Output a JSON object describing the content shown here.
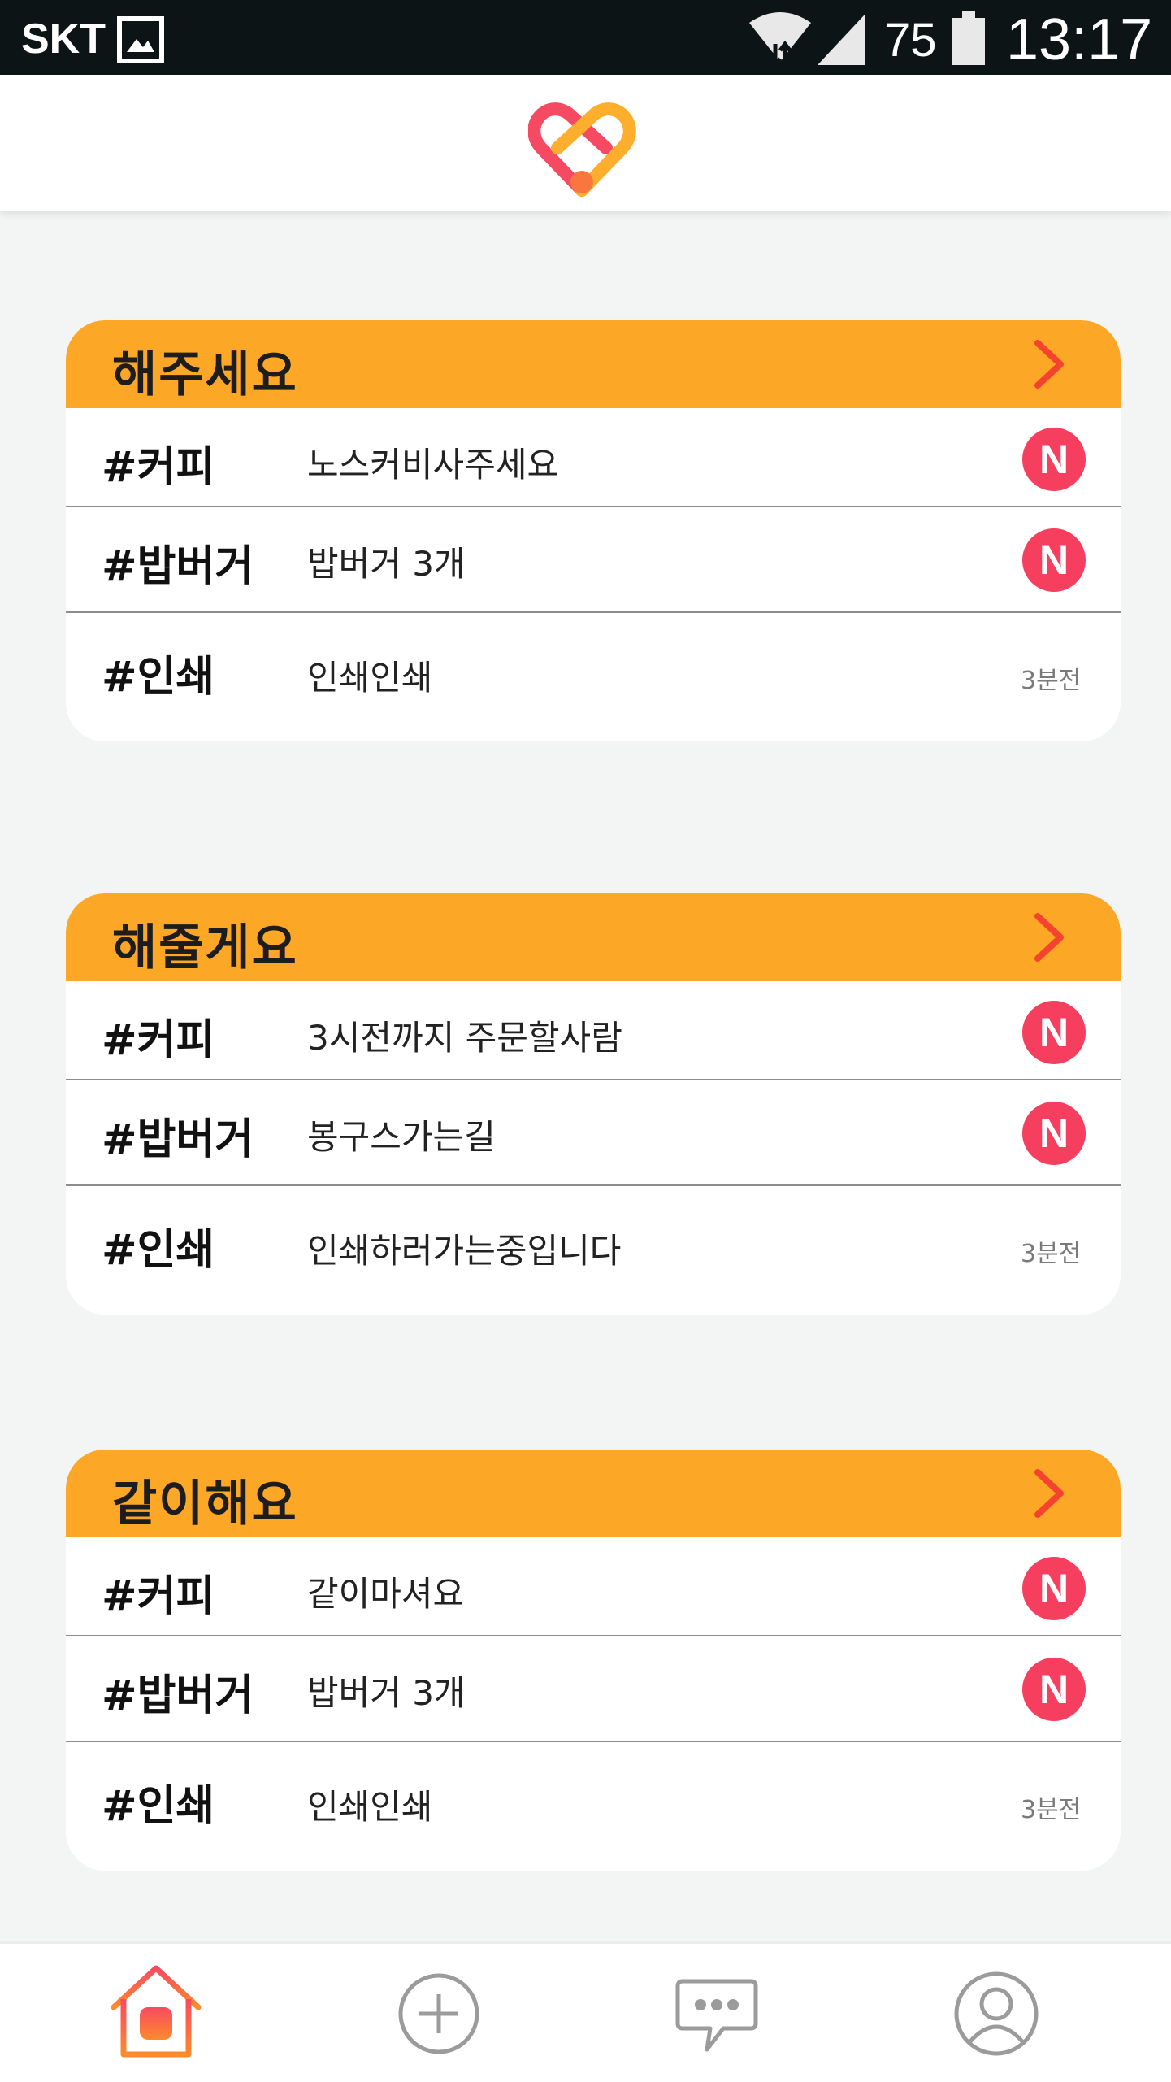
{
  "status_bar": {
    "carrier": "SKT",
    "battery_level": "75",
    "clock": "13:17",
    "icons": [
      "gallery-icon",
      "wifi-icon",
      "signal-icon",
      "battery-icon"
    ]
  },
  "header": {
    "logo_icon": "heart-handshake-logo"
  },
  "colors": {
    "accent": "#FDA726",
    "badge": "#F63F5E",
    "chevron": "#F4432E",
    "background": "#F3F4F4"
  },
  "sections": [
    {
      "title": "해주세요",
      "items": [
        {
          "tag": "#커피",
          "message": "노스커비사주세요",
          "badge": "N"
        },
        {
          "tag": "#밥버거",
          "message": "밥버거 3개",
          "badge": "N"
        },
        {
          "tag": "#인쇄",
          "message": "인쇄인쇄",
          "time": "3분전"
        }
      ]
    },
    {
      "title": "해줄게요",
      "items": [
        {
          "tag": "#커피",
          "message": "3시전까지 주문할사람",
          "badge": "N"
        },
        {
          "tag": "#밥버거",
          "message": "봉구스가는길",
          "badge": "N"
        },
        {
          "tag": "#인쇄",
          "message": "인쇄하러가는중입니다",
          "time": "3분전"
        }
      ]
    },
    {
      "title": "같이해요",
      "items": [
        {
          "tag": "#커피",
          "message": "같이마셔요",
          "badge": "N"
        },
        {
          "tag": "#밥버거",
          "message": "밥버거 3개",
          "badge": "N"
        },
        {
          "tag": "#인쇄",
          "message": "인쇄인쇄",
          "time": "3분전"
        }
      ]
    }
  ],
  "bottom_nav": [
    {
      "icon": "home-icon",
      "active": true
    },
    {
      "icon": "add-circle-icon",
      "active": false
    },
    {
      "icon": "chat-bubble-icon",
      "active": false
    },
    {
      "icon": "profile-icon",
      "active": false
    }
  ]
}
